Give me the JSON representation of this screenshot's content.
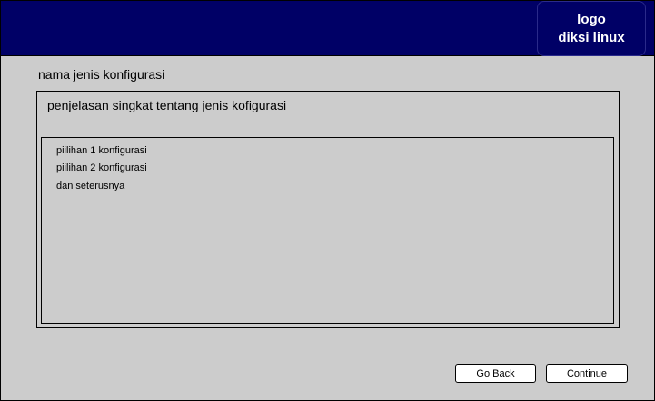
{
  "header": {
    "logo_line1": "logo",
    "logo_line2": "diksi linux"
  },
  "main": {
    "config_name": "nama jenis konfigurasi",
    "description": "penjelasan singkat tentang jenis kofigurasi",
    "options": [
      "piilihan 1 konfigurasi",
      "piilihan 2 konfigurasi",
      "dan seterusnya"
    ]
  },
  "footer": {
    "back_label": "Go Back",
    "continue_label": "Continue"
  },
  "colors": {
    "header_bg": "#000066",
    "window_bg": "#cccccc",
    "button_bg": "#ffffff"
  }
}
